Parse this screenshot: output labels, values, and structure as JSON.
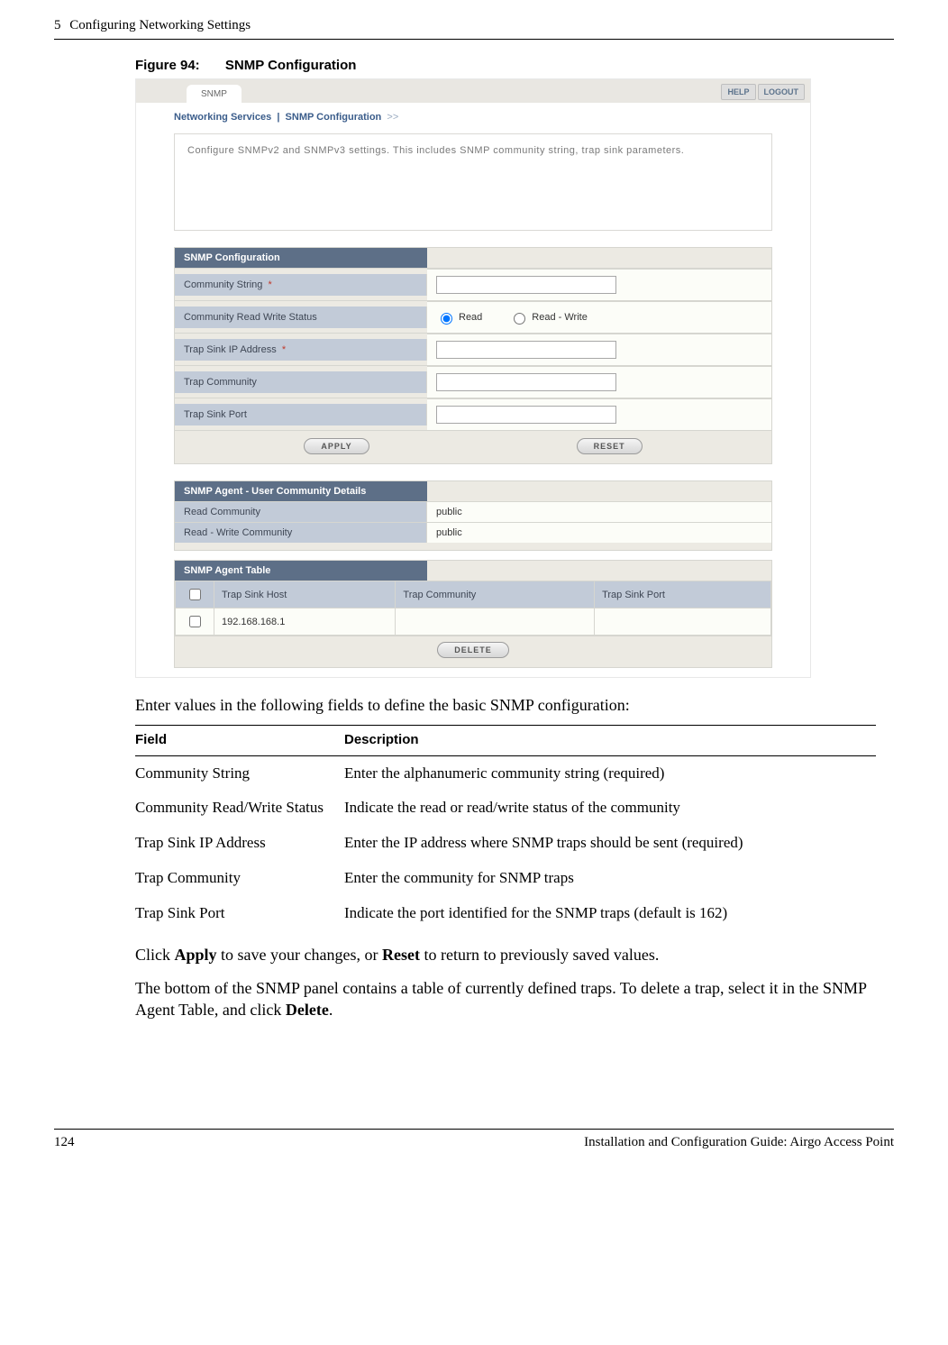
{
  "pageHeader": {
    "chapterNum": "5",
    "chapterTitle": "Configuring Networking Settings"
  },
  "figure": {
    "label": "Figure 94:",
    "title": "SNMP Configuration"
  },
  "tabs": {
    "snmp": "SNMP"
  },
  "topButtons": {
    "help": "HELP",
    "logout": "LOGOUT"
  },
  "breadcrumb": {
    "section": "Networking Services",
    "page": "SNMP Configuration",
    "separator": "|",
    "arrow": ">>"
  },
  "infobox": "Configure SNMPv2 and SNMPv3 settings. This includes SNMP community string, trap sink parameters.",
  "snmpConfig": {
    "heading": "SNMP Configuration",
    "rows": {
      "communityString": "Community String",
      "communityRWStatus": "Community Read Write Status",
      "trapSinkIP": "Trap Sink IP Address",
      "trapCommunity": "Trap Community",
      "trapSinkPort": "Trap Sink Port"
    },
    "required": "*",
    "radio": {
      "read": "Read",
      "readWrite": "Read - Write"
    },
    "buttons": {
      "apply": "APPLY",
      "reset": "RESET"
    }
  },
  "userCommunity": {
    "heading": "SNMP Agent - User Community Details",
    "rows": {
      "readCommunityLabel": "Read Community",
      "readCommunityValue": "public",
      "rwCommunityLabel": "Read - Write Community",
      "rwCommunityValue": "public"
    }
  },
  "agentTable": {
    "heading": "SNMP Agent Table",
    "cols": {
      "host": "Trap Sink Host",
      "community": "Trap Community",
      "port": "Trap Sink Port"
    },
    "row1": {
      "host": "192.168.168.1",
      "community": "",
      "port": ""
    },
    "deleteBtn": "DELETE"
  },
  "body": {
    "intro": "Enter values in the following fields to define the basic SNMP configuration:",
    "tableHead": {
      "field": "Field",
      "desc": "Description"
    },
    "rows": [
      {
        "f": "Community String",
        "d": "Enter the alphanumeric community string (required)"
      },
      {
        "f": "Community Read/Write Status",
        "d": "Indicate the read or read/write status of the community"
      },
      {
        "f": "Trap Sink IP Address",
        "d": "Enter the IP address where SNMP traps should be sent (required)"
      },
      {
        "f": "Trap Community",
        "d": "Enter the community for SNMP traps"
      },
      {
        "f": "Trap Sink Port",
        "d": "Indicate the port identified for the SNMP traps (default is 162)"
      }
    ],
    "para1a": "Click ",
    "para1b": "Apply",
    "para1c": " to save your changes, or ",
    "para1d": "Reset",
    "para1e": " to return to previously saved values.",
    "para2a": "The bottom of the SNMP panel contains a table of currently defined traps. To delete a trap, select it in the SNMP Agent Table, and click ",
    "para2b": "Delete",
    "para2c": "."
  },
  "footer": {
    "pageNum": "124",
    "docTitle": "Installation and Configuration Guide: Airgo Access Point"
  }
}
